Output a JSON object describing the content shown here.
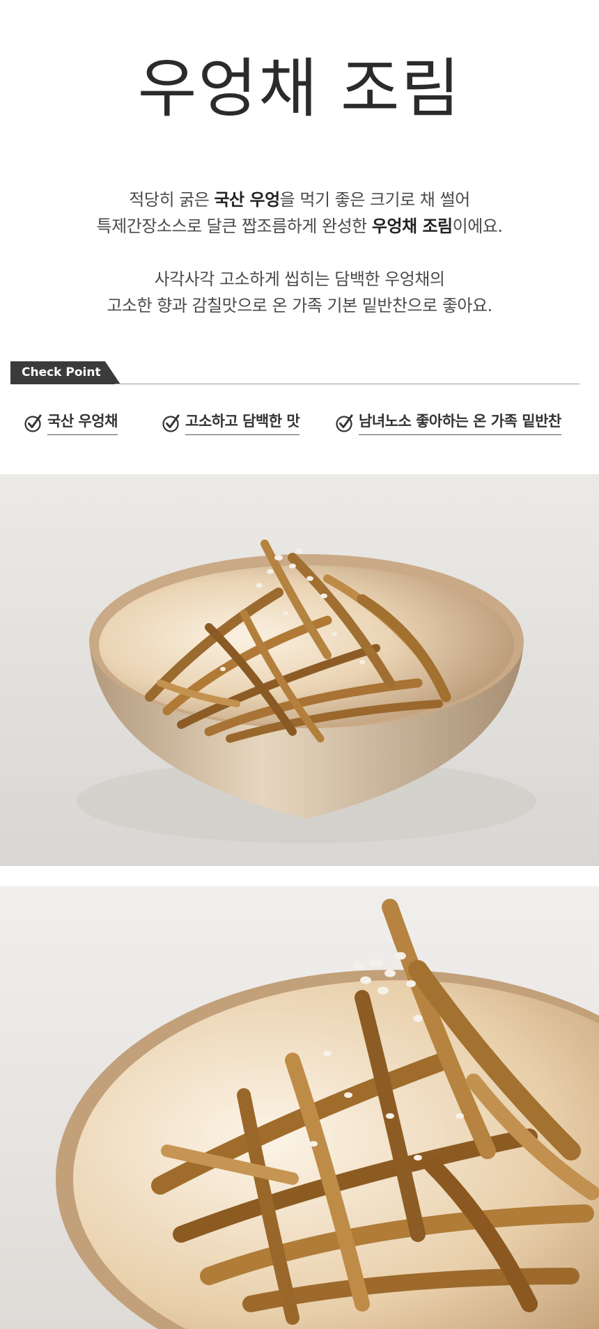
{
  "title": "우엉채 조림",
  "description": {
    "paragraph1": {
      "line1": {
        "a": "적당히 굵은 ",
        "b": "국산 우엉",
        "c": "을 먹기 좋은 크기로 채 썰어"
      },
      "line2": {
        "a": "특제간장소스로 달큰 짭조름하게 완성한 ",
        "b": "우엉채 조림",
        "c": "이에요."
      }
    },
    "paragraph2": {
      "line1": "사각사각 고소하게 씹히는 담백한 우엉채의",
      "line2": "고소한 향과 감칠맛으로 온 가족 기본 밑반찬으로 좋아요."
    }
  },
  "check_point": {
    "label": "Check Point",
    "items": [
      {
        "icon": "check-circle-icon",
        "text": "국산 우엉채"
      },
      {
        "icon": "check-circle-icon",
        "text": "고소하고 담백한 맛"
      },
      {
        "icon": "check-circle-icon",
        "text": "남녀노소 좋아하는 온 가족 밑반찬"
      }
    ]
  },
  "colors": {
    "label_bg": "#3b3b3b",
    "text": "#3a3a3a",
    "bowl": "#d9c3a3",
    "burdock": "#a9783a"
  }
}
